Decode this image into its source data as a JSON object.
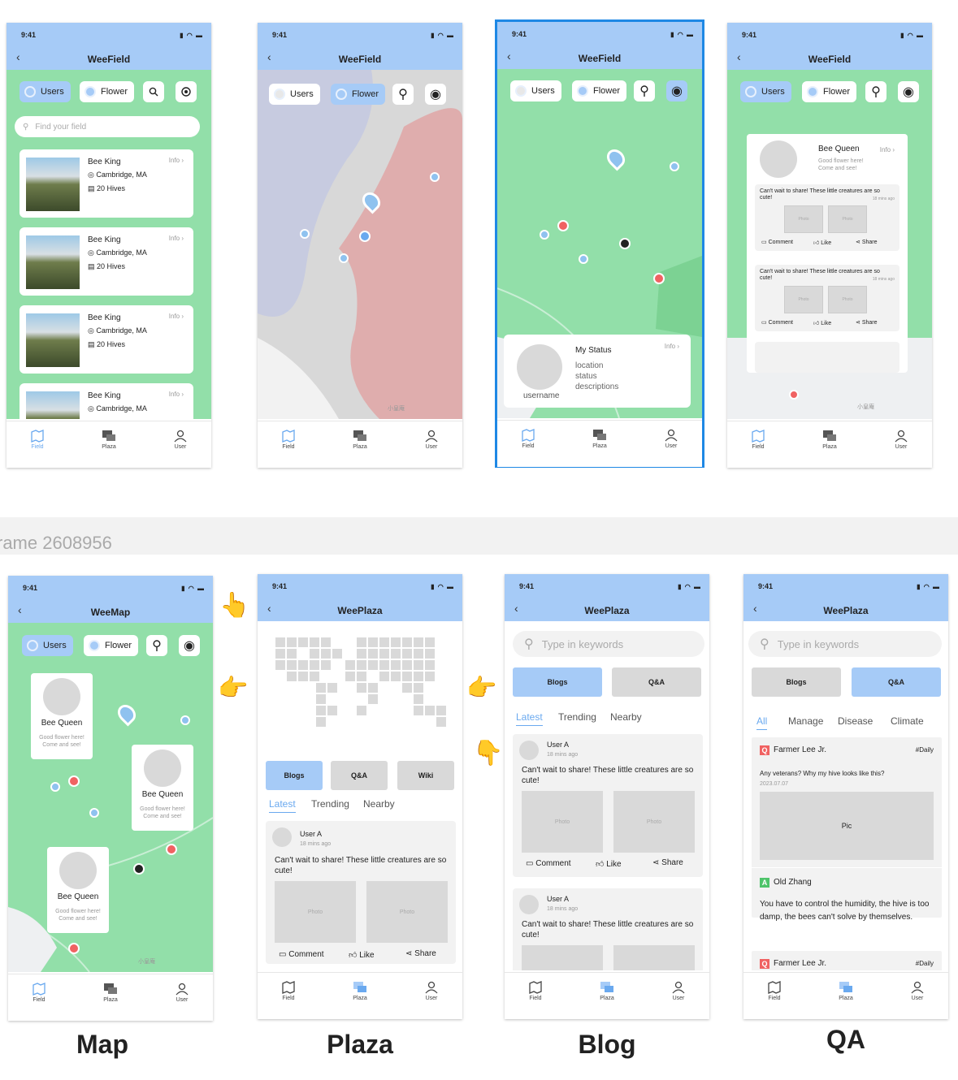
{
  "status": {
    "time": "9:41"
  },
  "screens": {
    "field_list": {
      "title": "WeeField",
      "search_placeholder": "Find your field"
    },
    "field_map": {
      "title": "WeeField"
    },
    "field_status": {
      "title": "WeeField",
      "status_card": {
        "title": "My Status",
        "info": "Info",
        "lines": [
          "location",
          "status",
          "descriptions"
        ],
        "username": "username"
      }
    },
    "field_post": {
      "title": "WeeField"
    },
    "map": {
      "title": "WeeMap"
    },
    "plaza": {
      "title": "WeePlaza",
      "buttons": [
        "Blogs",
        "Q&A",
        "Wiki"
      ]
    },
    "blog": {
      "title": "WeePlaza",
      "search_placeholder": "Type in keywords",
      "buttons": [
        "Blogs",
        "Q&A"
      ]
    },
    "qa": {
      "title": "WeePlaza",
      "search_placeholder": "Type in keywords",
      "buttons": [
        "Blogs",
        "Q&A"
      ]
    }
  },
  "filters": {
    "users": "Users",
    "flower": "Flower"
  },
  "map_label": "小皇庵",
  "field_cards": [
    {
      "name": "Bee King",
      "info": "Info",
      "location": "Cambridge, MA",
      "hives": "20 Hives"
    },
    {
      "name": "Bee King",
      "info": "Info",
      "location": "Cambridge, MA",
      "hives": "20 Hives"
    },
    {
      "name": "Bee King",
      "info": "Info",
      "location": "Cambridge, MA",
      "hives": "20 Hives"
    },
    {
      "name": "Bee King",
      "info": "Info",
      "location": "Cambridge, MA"
    }
  ],
  "queen": {
    "name": "Bee Queen",
    "info": "Info",
    "desc1": "Good flower here!",
    "desc2": "Come and see!"
  },
  "mini_post": {
    "text": "Can't wait to share!  These little creatures are so cute!",
    "time": "18 mins ago",
    "photo": "Photo",
    "comment": "Comment",
    "like": "Like",
    "share": "Share"
  },
  "blog_tabs": [
    "Latest",
    "Trending",
    "Nearby"
  ],
  "post": {
    "user": "User A",
    "time": "18 mins ago",
    "text": "Can't wait to share!  These little creatures are so cute!",
    "photo": "Photo",
    "comment": "Comment",
    "like": "Like",
    "share": "Share"
  },
  "qa_tabs": [
    "All",
    "Manage",
    "Disease",
    "Climate"
  ],
  "qa_items": [
    {
      "badge": "Q",
      "user": "Farmer Lee Jr.",
      "tag": "#Daily",
      "question": "Any veterans? Why my hive looks like this?",
      "date": "2023.07.07",
      "pic": "Pic"
    },
    {
      "badge": "A",
      "user": "Old Zhang",
      "answer": "You have to control the humidity, the hive is too damp, the bees can't solve by themselves."
    },
    {
      "badge": "Q",
      "user": "Farmer Lee Jr.",
      "tag": "#Daily"
    }
  ],
  "nav": {
    "field": "Field",
    "plaza": "Plaza",
    "user": "User"
  },
  "frame_label": "rame 2608956",
  "captions": {
    "map": "Map",
    "plaza": "Plaza",
    "blog": "Blog",
    "qa": "QA"
  },
  "colors": {
    "header": "#a6cbf7",
    "map_green": "#92dfa9",
    "selected_frame": "#1e88e5",
    "pin_red": "#f06262",
    "accent_blue": "#6aa9ef"
  }
}
